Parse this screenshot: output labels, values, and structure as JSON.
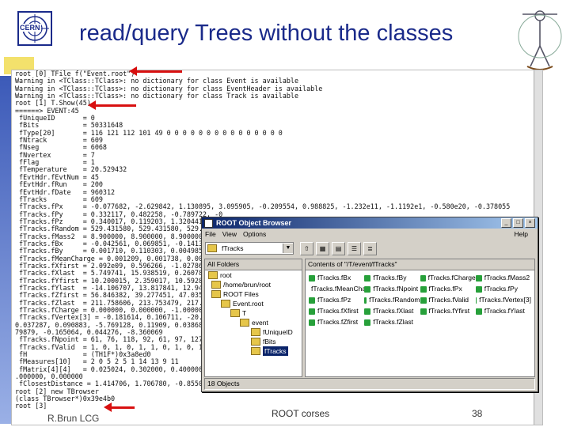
{
  "title": "read/query Trees without the classes",
  "colors": {
    "title": "#1a2a8a",
    "arrow": "#d81010",
    "titlebar_start": "#0a246a",
    "titlebar_end": "#a6caf0",
    "leaf": "#27a03a",
    "folder": "#e6c64a"
  },
  "logo": {
    "text": "CERN",
    "icon": "cern-logo-icon"
  },
  "figure_icon": "vitruvian-figure-icon",
  "terminal_lines": [
    "root [0] TFile f(\"Event.root\")",
    "Warning in <TClass::TClass>: no dictionary for class Event is available",
    "Warning in <TClass::TClass>: no dictionary for class EventHeader is available",
    "Warning in <TClass::TClass>: no dictionary for class Track is available",
    "root [1] T.Show(45)",
    "======> EVENT:45",
    " fUniqueID       = 0",
    " fBits           = 50331648",
    " fType[20]       = 116 121 112 101 49 0 0 0 0 0 0 0 0 0 0 0 0 0 0 0",
    " fNtrack         = 609",
    " fNseg           = 6068",
    " fNvertex        = 7",
    " fFlag           = 1",
    " fTemperature    = 20.529432",
    " fEvtHdr.fEvtNum = 45",
    " fEvtHdr.fRun    = 200",
    " fEvtHdr.fDate   = 960312",
    " fTracks         = 609",
    " fTracks.fPx     = -0.077682, -2.629842, 1.130895, 3.095905, -0.209554, 0.988825, -1.232e11, -1.1192e1, -0.580e20, -0.378055",
    " fTracks.fPy     = 0.332117, 0.482258, -0.789722, -0",
    " fTracks.fPz     = 0.340017, 0.119203, 1.320441, 3.0",
    " fTracks.fRandom = 529.431580, 529.431580, 529.431580",
    " fTracks.fMass2  = 8.900000, 8.900000, 8.900000, 8.9",
    " fTracks.fBx     = -0.042561, 0.069851, -0.141384, 0",
    " fTracks.fBy     = 0.001710, 0.110303, 0.004985, 0.",
    " fTracks.fMeanCharge = 0.001209, 0.001738, 0.006828",
    " fTracks.fXfirst = 2.092e09, 0.596266, -1.027864, -9",
    " fTracks.fXlast  = 5.749741, 15.938519, 0.260784, 14",
    " fTracks.fYfirst = 10.200015, 2.359017, 10.592875,",
    " fTracks.fYlast  = -14.106707, 13.817841, 12.946399,",
    " fTracks.fZfirst = 56.846382, 39.277451, 47.035570,",
    " fTracks.fZlast  = 211.758606, 213.753479, 217.625647",
    " fTracks.fCharge = 0.000000, 0.000000, -1.000000, 0",
    " fTracks.fVertex[3] = -0.181614, 0.106711, -20.076854",
    "0.037287, 0.090883, -5.769128, 0.11909, 0.038680, -1",
    "79879, -0.165064, 0.044276, -8.360069",
    " fTracks.fNpoint = 61, 76, 118, 92, 61, 97, 127, 12",
    " fTracks.fValid  = 1, 0, 1, 0, 1, 1, 0, 1, 0, 1",
    " fH              = (TH1F*)0x3a8ed0",
    " fMeasures[10]   = 2 0 5 2 5 1 14 13 9 11",
    " fMatrix[4][4]   = 0.025024, 0.302000, 0.400000, 0.000000,",
    ".000000, 0.000000",
    " fClosestDistance = 1.414706, 1.706780, -0.855089, 1.539576, 0.804150, 0.04821, -0.599909",
    "root [2] new TBrowser",
    "(class TBrowser*)0x39e4b0",
    "root [3]"
  ],
  "browser": {
    "title": "ROOT Object Browser",
    "menu": [
      "File",
      "View",
      "Options"
    ],
    "help": "Help",
    "combo_value": "fTracks",
    "toolbar_icons": [
      "up-folder-icon",
      "large-icons-icon",
      "small-icons-icon",
      "list-view-icon",
      "details-view-icon"
    ],
    "left_header": "All Folders",
    "tree": [
      "root",
      "/home/brun/root",
      "ROOT Files",
      "Event.root",
      "T",
      "event",
      "fUniqueID",
      "fBits",
      "fTracks"
    ],
    "right_header": "Contents of \"/T/event/fTracks\"",
    "items": [
      "fTracks.fBx",
      "fTracks.fBy",
      "fTracks.fCharge",
      "fTracks.fMass2",
      "fTracks.fMeanCharge",
      "fTracks.fNpoint",
      "fTracks.fPx",
      "fTracks.fPy",
      "fTracks.fPz",
      "fTracks.fRandom",
      "fTracks.fValid",
      "fTracks.fVertex[3]",
      "fTracks.fXfirst",
      "fTracks.fXlast",
      "fTracks.fYfirst",
      "fTracks.fYlast",
      "fTracks.fZfirst",
      "fTracks.fZlast"
    ],
    "status": "18 Objects"
  },
  "footer": {
    "left": "R.Brun LCG",
    "center": "ROOT corses",
    "page": "38"
  }
}
